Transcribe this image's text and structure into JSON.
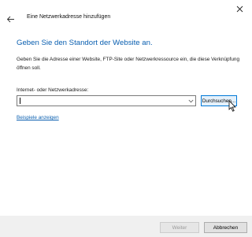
{
  "window": {
    "close_icon": "close-icon",
    "back_icon": "back-arrow-icon",
    "title": "Eine Netzwerkadresse hinzufügen"
  },
  "main": {
    "heading": "Geben Sie den Standort der Website an.",
    "description": "Geben Sie die Adresse einer Website, FTP-Site oder Netzwerkressource ein, die diese Verknüpfung öffnen soll.",
    "address_label": "Internet- oder Netzwerkadresse:",
    "address_value": "",
    "browse_label": "Durchsuchen...",
    "examples_link": "Beispiele anzeigen"
  },
  "footer": {
    "next_label": "Weiter",
    "cancel_label": "Abbrechen"
  },
  "colors": {
    "heading": "#0a5fb0",
    "link": "#0a5fb0",
    "focus_border": "#0078d7"
  }
}
